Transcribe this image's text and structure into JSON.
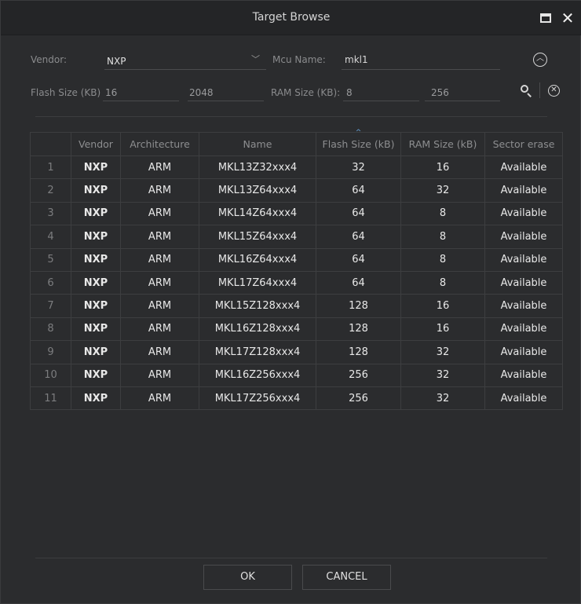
{
  "window": {
    "title": "Target Browse"
  },
  "filters": {
    "vendor_label": "Vendor:",
    "vendor_value": "NXP",
    "mcu_label": "Mcu Name:",
    "mcu_value": "mkl1",
    "flash_label": "Flash Size (KB)",
    "flash_min": "16",
    "flash_max": "2048",
    "ram_label": "RAM Size (KB):",
    "ram_min": "8",
    "ram_max": "256"
  },
  "table": {
    "headers": [
      "",
      "Vendor",
      "Architecture",
      "Name",
      "Flash Size (kB)",
      "RAM Size (kB)",
      "Sector erase"
    ],
    "rows": [
      [
        "1",
        "NXP",
        "ARM",
        "MKL13Z32xxx4",
        "32",
        "16",
        "Available"
      ],
      [
        "2",
        "NXP",
        "ARM",
        "MKL13Z64xxx4",
        "64",
        "32",
        "Available"
      ],
      [
        "3",
        "NXP",
        "ARM",
        "MKL14Z64xxx4",
        "64",
        "8",
        "Available"
      ],
      [
        "4",
        "NXP",
        "ARM",
        "MKL15Z64xxx4",
        "64",
        "8",
        "Available"
      ],
      [
        "5",
        "NXP",
        "ARM",
        "MKL16Z64xxx4",
        "64",
        "8",
        "Available"
      ],
      [
        "6",
        "NXP",
        "ARM",
        "MKL17Z64xxx4",
        "64",
        "8",
        "Available"
      ],
      [
        "7",
        "NXP",
        "ARM",
        "MKL15Z128xxx4",
        "128",
        "16",
        "Available"
      ],
      [
        "8",
        "NXP",
        "ARM",
        "MKL16Z128xxx4",
        "128",
        "16",
        "Available"
      ],
      [
        "9",
        "NXP",
        "ARM",
        "MKL17Z128xxx4",
        "128",
        "32",
        "Available"
      ],
      [
        "10",
        "NXP",
        "ARM",
        "MKL16Z256xxx4",
        "256",
        "32",
        "Available"
      ],
      [
        "11",
        "NXP",
        "ARM",
        "MKL17Z256xxx4",
        "256",
        "32",
        "Available"
      ]
    ]
  },
  "buttons": {
    "ok": "OK",
    "cancel": "CANCEL"
  },
  "icons": {
    "maximize": "maximize-icon",
    "close": "close-icon",
    "chevron": "chevron-down-icon",
    "collapse": "chevron-up-circle-icon",
    "search": "search-icon",
    "clear": "clear-circle-icon",
    "sort": "sort-ascending-icon"
  },
  "colors": {
    "background": "#2b2c2e",
    "titlebar": "#242527",
    "sort_accent": "#6aa8e0"
  }
}
